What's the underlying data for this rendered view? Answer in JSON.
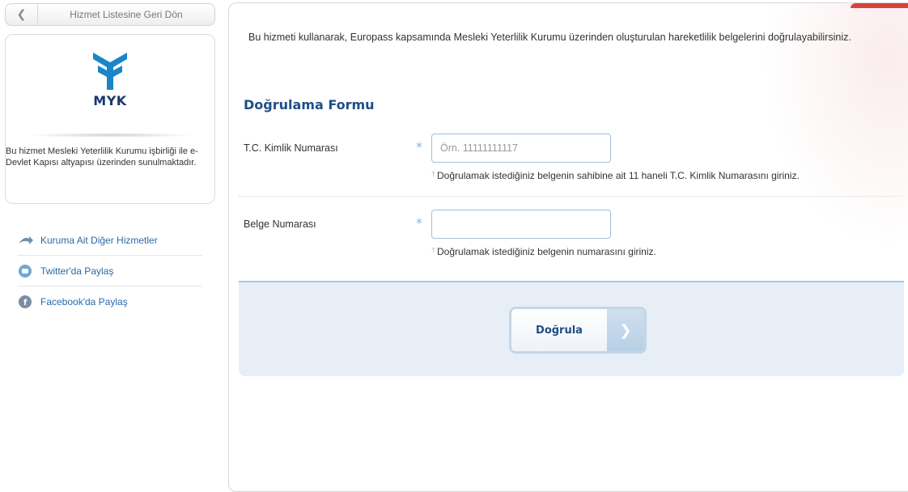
{
  "left": {
    "back_button": {
      "label": "Hizmet Listesine Geri Dön",
      "icon": "chevron-left-icon"
    },
    "agency": {
      "logo_text": "MYK",
      "description": "Bu hizmet Mesleki Yeterlilik Kurumu işbirliği ile e-Devlet Kapısı altyapısı üzerinden sunulmaktadır."
    },
    "links": [
      {
        "label": "Kuruma Ait Diğer Hizmetler",
        "icon": "services-arrow-icon"
      },
      {
        "label": "Twitter'da Paylaş",
        "icon": "twitter-icon"
      },
      {
        "label": "Facebook'da Paylaş",
        "icon": "facebook-icon"
      }
    ]
  },
  "main": {
    "intro": "Bu hizmeti kullanarak, Europass kapsamında Mesleki Yeterlilik Kurumu üzerinden oluşturulan hareketlilik belgelerini doğrulayabilirsiniz.",
    "form_title": "Doğrulama Formu",
    "fields": [
      {
        "label": "T.C. Kimlik Numarası",
        "required_mark": "*",
        "value": "",
        "placeholder": "Örn. 11111111117",
        "hint": "Doğrulamak istediğiniz belgenin sahibine ait 11 haneli T.C. Kimlik Numarasını giriniz."
      },
      {
        "label": "Belge Numarası",
        "required_mark": "*",
        "value": "",
        "placeholder": "",
        "hint": "Doğrulamak istediğiniz belgenin numarasını giriniz."
      }
    ],
    "submit": {
      "label": "Doğrula",
      "icon": "chevron-right-icon"
    }
  },
  "colors": {
    "accent_blue": "#1f4f86",
    "link_blue": "#2a6aa8",
    "action_bar": "#e7eef5",
    "input_border": "#9ec1de"
  }
}
